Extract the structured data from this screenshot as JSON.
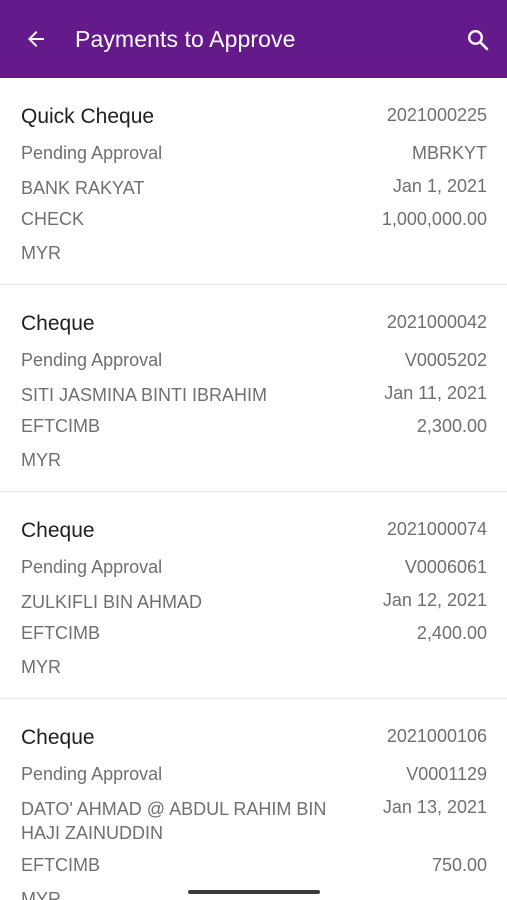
{
  "header": {
    "title": "Payments to Approve",
    "background": "#651a8c",
    "back_icon": "arrow-left-icon",
    "search_icon": "search-icon"
  },
  "payments": [
    {
      "type": "Quick Cheque",
      "number": "2021000225",
      "status": "Pending Approval",
      "code": "MBRKYT",
      "payee": "BANK RAKYAT",
      "date": "Jan 1, 2021",
      "method": "CHECK",
      "amount": "1,000,000.00",
      "currency": "MYR"
    },
    {
      "type": "Cheque",
      "number": "2021000042",
      "status": "Pending Approval",
      "code": "V0005202",
      "payee": "SITI JASMINA BINTI IBRAHIM",
      "date": "Jan 11, 2021",
      "method": "EFTCIMB",
      "amount": "2,300.00",
      "currency": "MYR"
    },
    {
      "type": "Cheque",
      "number": "2021000074",
      "status": "Pending Approval",
      "code": "V0006061",
      "payee": "ZULKIFLI BIN AHMAD",
      "date": "Jan 12, 2021",
      "method": "EFTCIMB",
      "amount": "2,400.00",
      "currency": "MYR"
    },
    {
      "type": "Cheque",
      "number": "2021000106",
      "status": "Pending Approval",
      "code": "V0001129",
      "payee": "DATO' AHMAD @ ABDUL RAHIM BIN HAJI ZAINUDDIN",
      "date": "Jan 13, 2021",
      "method": "EFTCIMB",
      "amount": "750.00",
      "currency": "MYR"
    }
  ]
}
